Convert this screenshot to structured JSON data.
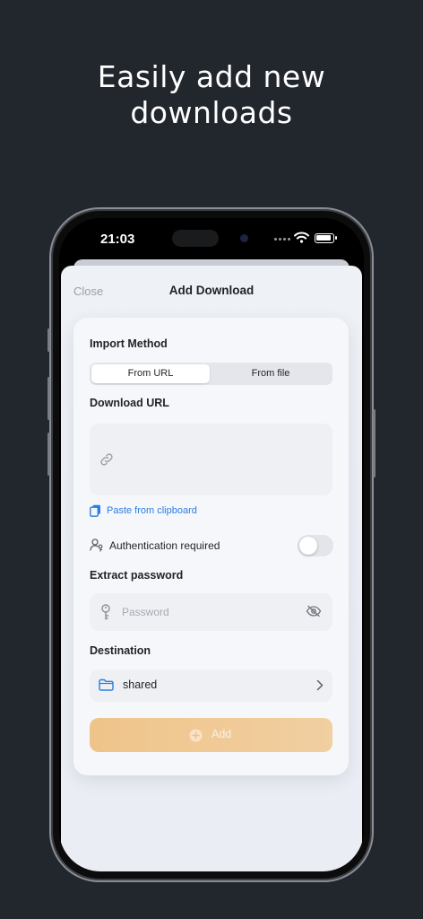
{
  "headline": {
    "line1": "Easily add new",
    "line2": "downloads"
  },
  "status_bar": {
    "time": "21:03"
  },
  "sheet": {
    "close_label": "Close",
    "title": "Add Download"
  },
  "form": {
    "import_method_label": "Import Method",
    "segments": [
      {
        "label": "From URL",
        "selected": true
      },
      {
        "label": "From file",
        "selected": false
      }
    ],
    "download_url_label": "Download URL",
    "paste_label": "Paste from clipboard",
    "auth_label": "Authentication required",
    "auth_enabled": false,
    "extract_password_label": "Extract password",
    "password_placeholder": "Password",
    "destination_label": "Destination",
    "destination_value": "shared",
    "add_label": "Add"
  },
  "colors": {
    "background": "#22262d",
    "accent_link": "#2a7de1",
    "add_button": "#efc48a"
  },
  "icons": [
    "link-icon",
    "clipboard-icon",
    "user-key-icon",
    "key-icon",
    "eye-slash-icon",
    "folder-icon",
    "chevron-right-icon",
    "plus-circle-icon"
  ]
}
